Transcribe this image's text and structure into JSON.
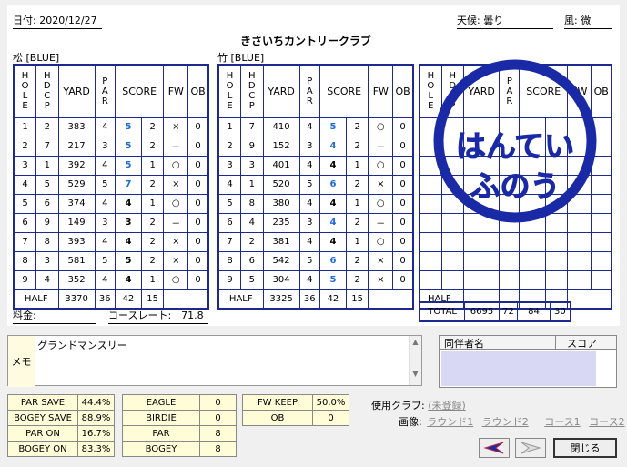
{
  "header": {
    "date": "日付: 2020/12/27",
    "club": "きさいちカントリークラブ",
    "weather": "天候: 曇り",
    "wind": "風: 微"
  },
  "col_headers": [
    "HOLE",
    "HDCP",
    "YARD",
    "PAR",
    "SCORE",
    "FW",
    "OB"
  ],
  "out": {
    "label": "松 [BLUE]",
    "rows": [
      {
        "hole": "1",
        "hdcp": "2",
        "yard": "383",
        "par": "4",
        "score": "5",
        "putt": "2",
        "fw": "×",
        "ob": "0"
      },
      {
        "hole": "2",
        "hdcp": "7",
        "yard": "217",
        "par": "3",
        "score": "5",
        "putt": "2",
        "fw": "－",
        "ob": "0"
      },
      {
        "hole": "3",
        "hdcp": "1",
        "yard": "392",
        "par": "4",
        "score": "5",
        "putt": "1",
        "fw": "○",
        "ob": "0"
      },
      {
        "hole": "4",
        "hdcp": "5",
        "yard": "529",
        "par": "5",
        "score": "7",
        "putt": "2",
        "fw": "×",
        "ob": "0"
      },
      {
        "hole": "5",
        "hdcp": "6",
        "yard": "374",
        "par": "4",
        "score": "4",
        "putt": "1",
        "fw": "○",
        "ob": "0"
      },
      {
        "hole": "6",
        "hdcp": "9",
        "yard": "149",
        "par": "3",
        "score": "3",
        "putt": "2",
        "fw": "－",
        "ob": "0"
      },
      {
        "hole": "7",
        "hdcp": "8",
        "yard": "393",
        "par": "4",
        "score": "4",
        "putt": "2",
        "fw": "×",
        "ob": "0"
      },
      {
        "hole": "8",
        "hdcp": "3",
        "yard": "581",
        "par": "5",
        "score": "5",
        "putt": "2",
        "fw": "×",
        "ob": "0"
      },
      {
        "hole": "9",
        "hdcp": "4",
        "yard": "352",
        "par": "4",
        "score": "4",
        "putt": "1",
        "fw": "○",
        "ob": "0"
      }
    ],
    "half": {
      "label": "HALF",
      "yard": "3370",
      "par": "36",
      "score": "42",
      "putt": "15"
    }
  },
  "in": {
    "label": "竹 [BLUE]",
    "rows": [
      {
        "hole": "1",
        "hdcp": "7",
        "yard": "410",
        "par": "4",
        "score": "5",
        "putt": "2",
        "fw": "○",
        "ob": "0"
      },
      {
        "hole": "2",
        "hdcp": "9",
        "yard": "152",
        "par": "3",
        "score": "4",
        "putt": "2",
        "fw": "－",
        "ob": "0"
      },
      {
        "hole": "3",
        "hdcp": "3",
        "yard": "401",
        "par": "4",
        "score": "4",
        "putt": "1",
        "fw": "○",
        "ob": "0"
      },
      {
        "hole": "4",
        "hdcp": "1",
        "yard": "520",
        "par": "5",
        "score": "6",
        "putt": "2",
        "fw": "×",
        "ob": "0"
      },
      {
        "hole": "5",
        "hdcp": "8",
        "yard": "380",
        "par": "4",
        "score": "4",
        "putt": "1",
        "fw": "○",
        "ob": "0"
      },
      {
        "hole": "6",
        "hdcp": "4",
        "yard": "235",
        "par": "3",
        "score": "4",
        "putt": "2",
        "fw": "－",
        "ob": "0"
      },
      {
        "hole": "7",
        "hdcp": "2",
        "yard": "381",
        "par": "4",
        "score": "4",
        "putt": "1",
        "fw": "○",
        "ob": "0"
      },
      {
        "hole": "8",
        "hdcp": "6",
        "yard": "542",
        "par": "5",
        "score": "6",
        "putt": "2",
        "fw": "×",
        "ob": "0"
      },
      {
        "hole": "9",
        "hdcp": "5",
        "yard": "304",
        "par": "4",
        "score": "5",
        "putt": "2",
        "fw": "×",
        "ob": "0"
      }
    ],
    "half": {
      "label": "HALF",
      "yard": "3325",
      "par": "36",
      "score": "42",
      "putt": "15"
    }
  },
  "extra": {
    "half_label": "HALF"
  },
  "total": {
    "label": "TOTAL",
    "yard": "6695",
    "par": "72",
    "score": "84",
    "putt": "30"
  },
  "stamp": {
    "line1": "はんてい",
    "line2": "ふのう"
  },
  "fee_label": "料金:",
  "course_rate": "コースレート:　71.8",
  "memo": {
    "label": "メモ",
    "text": "グランドマンスリー"
  },
  "companions": {
    "col_name": "同伴者名",
    "col_score": "スコア"
  },
  "stats1": [
    [
      "PAR SAVE",
      "44.4%"
    ],
    [
      "BOGEY SAVE",
      "88.9%"
    ],
    [
      "PAR ON",
      "16.7%"
    ],
    [
      "BOGEY ON",
      "83.3%"
    ]
  ],
  "stats2": [
    [
      "EAGLE",
      "0"
    ],
    [
      "BIRDIE",
      "0"
    ],
    [
      "PAR",
      "8"
    ],
    [
      "BOGEY",
      "8"
    ]
  ],
  "stats3": [
    [
      "FW KEEP",
      "50.0%"
    ],
    [
      "OB",
      "0"
    ]
  ],
  "clubs": {
    "label": "使用クラブ:",
    "value": "(未登録)"
  },
  "images": {
    "label": "画像:",
    "items": [
      "ラウンド1",
      "ラウンド2",
      "コース1",
      "コース2"
    ]
  },
  "buttons": {
    "close": "閉じる"
  },
  "colors": {
    "table_border": "#1c2a90",
    "score_blue": "#1d6ad8",
    "stamp": "#1a2aa6"
  }
}
